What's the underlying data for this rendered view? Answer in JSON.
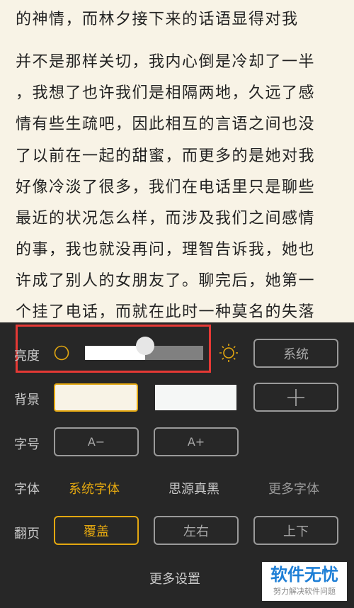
{
  "reader": {
    "lines": [
      "的神情，而林夕接下来的话语显得对我",
      "并不是那样关切，我内心倒是冷却了一半",
      "，我想了也许我们是相隔两地，久远了感",
      "情有些生疏吧，因此相互的言语之间也没",
      "了以前在一起的甜蜜，而更多的是她对我",
      "好像冷淡了很多，我们在电话里只是聊些",
      "最近的状况怎么样，而涉及我们之间感情",
      "的事，我也就没再问，理智告诉我，她也",
      "许成了别人的女朋友了。聊完后，她第一",
      "个挂了电话，而就在此时一种莫名的失落"
    ]
  },
  "settings": {
    "brightness": {
      "label": "亮度",
      "level": 0.51,
      "system": "系统"
    },
    "background": {
      "label": "背景",
      "options": [
        "#f8f3e6",
        "#f5f7f6"
      ],
      "selected": 0
    },
    "font_size": {
      "label": "字号",
      "decrease": "A−",
      "increase": "A+"
    },
    "font": {
      "label": "字体",
      "options": [
        "系统字体",
        "思源真黑",
        "更多字体"
      ],
      "selected": 0
    },
    "page_turn": {
      "label": "翻页",
      "options": [
        "覆盖",
        "左右",
        "上下"
      ],
      "selected": 0
    },
    "more": "更多设置"
  },
  "watermark": {
    "title": "软件无忧",
    "subtitle": "努力解决软件问题"
  },
  "colors": {
    "accent": "#e3a710",
    "highlight": "#e53935",
    "panel": "#272727"
  }
}
